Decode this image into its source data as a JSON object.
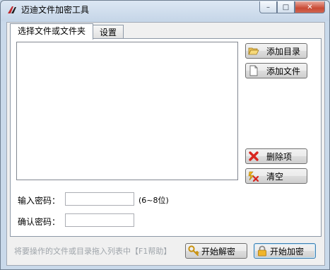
{
  "window": {
    "title": "迈迪文件加密工具",
    "min_label": "–",
    "max_label": "□",
    "close_label": "✕"
  },
  "tabs": [
    {
      "label": "选择文件或文件夹",
      "active": true
    },
    {
      "label": "设置",
      "active": false
    }
  ],
  "side_buttons": {
    "add_dir": "添加目录",
    "add_file": "添加文件",
    "delete_item": "删除项",
    "clear": "清空"
  },
  "password": {
    "label": "输入密码：",
    "value": "",
    "hint": "(6~8位)"
  },
  "confirm": {
    "label": "确认密码：",
    "value": ""
  },
  "status": "将要操作的文件或目录拖入列表中【F1帮助】",
  "actions": {
    "decrypt": "开始解密",
    "encrypt": "开始加密"
  },
  "colors": {
    "accent": "#3c7fb1",
    "close": "#c94a34"
  }
}
